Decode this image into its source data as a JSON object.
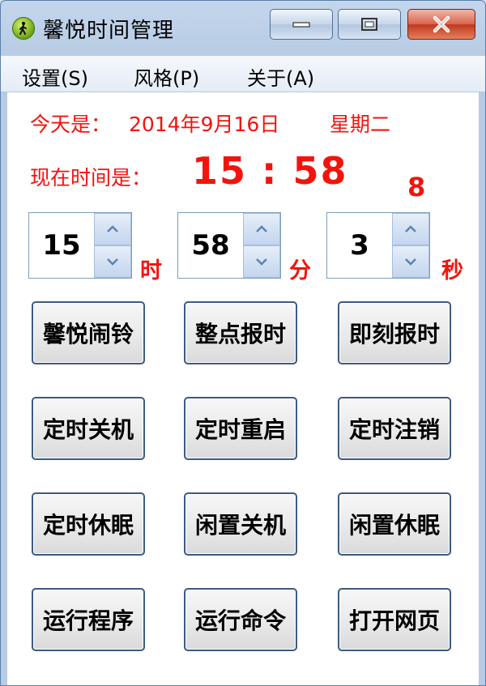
{
  "window": {
    "title": "馨悦时间管理"
  },
  "menu": {
    "settings": "设置(S)",
    "style": "风格(P)",
    "about": "关于(A)"
  },
  "info": {
    "today_label": "今天是：",
    "today_date": "2014年9月16日",
    "weekday": "星期二",
    "now_label": "现在时间是：",
    "now_time": "15 : 58",
    "now_seconds": "8"
  },
  "spinners": {
    "hour": {
      "value": "15",
      "unit": "时"
    },
    "minute": {
      "value": "58",
      "unit": "分"
    },
    "second": {
      "value": "3",
      "unit": "秒"
    }
  },
  "buttons": [
    "馨悦闹铃",
    "整点报时",
    "即刻报时",
    "定时关机",
    "定时重启",
    "定时注销",
    "定时休眠",
    "闲置关机",
    "闲置休眠",
    "运行程序",
    "运行命令",
    "打开网页"
  ],
  "colors": {
    "accent_red": "#f2140c",
    "frame_blue": "#b7cbe4"
  },
  "icons": [
    "walking-person-icon",
    "minimize-icon",
    "maximize-icon",
    "close-icon",
    "up-arrow-icon",
    "down-arrow-icon"
  ]
}
